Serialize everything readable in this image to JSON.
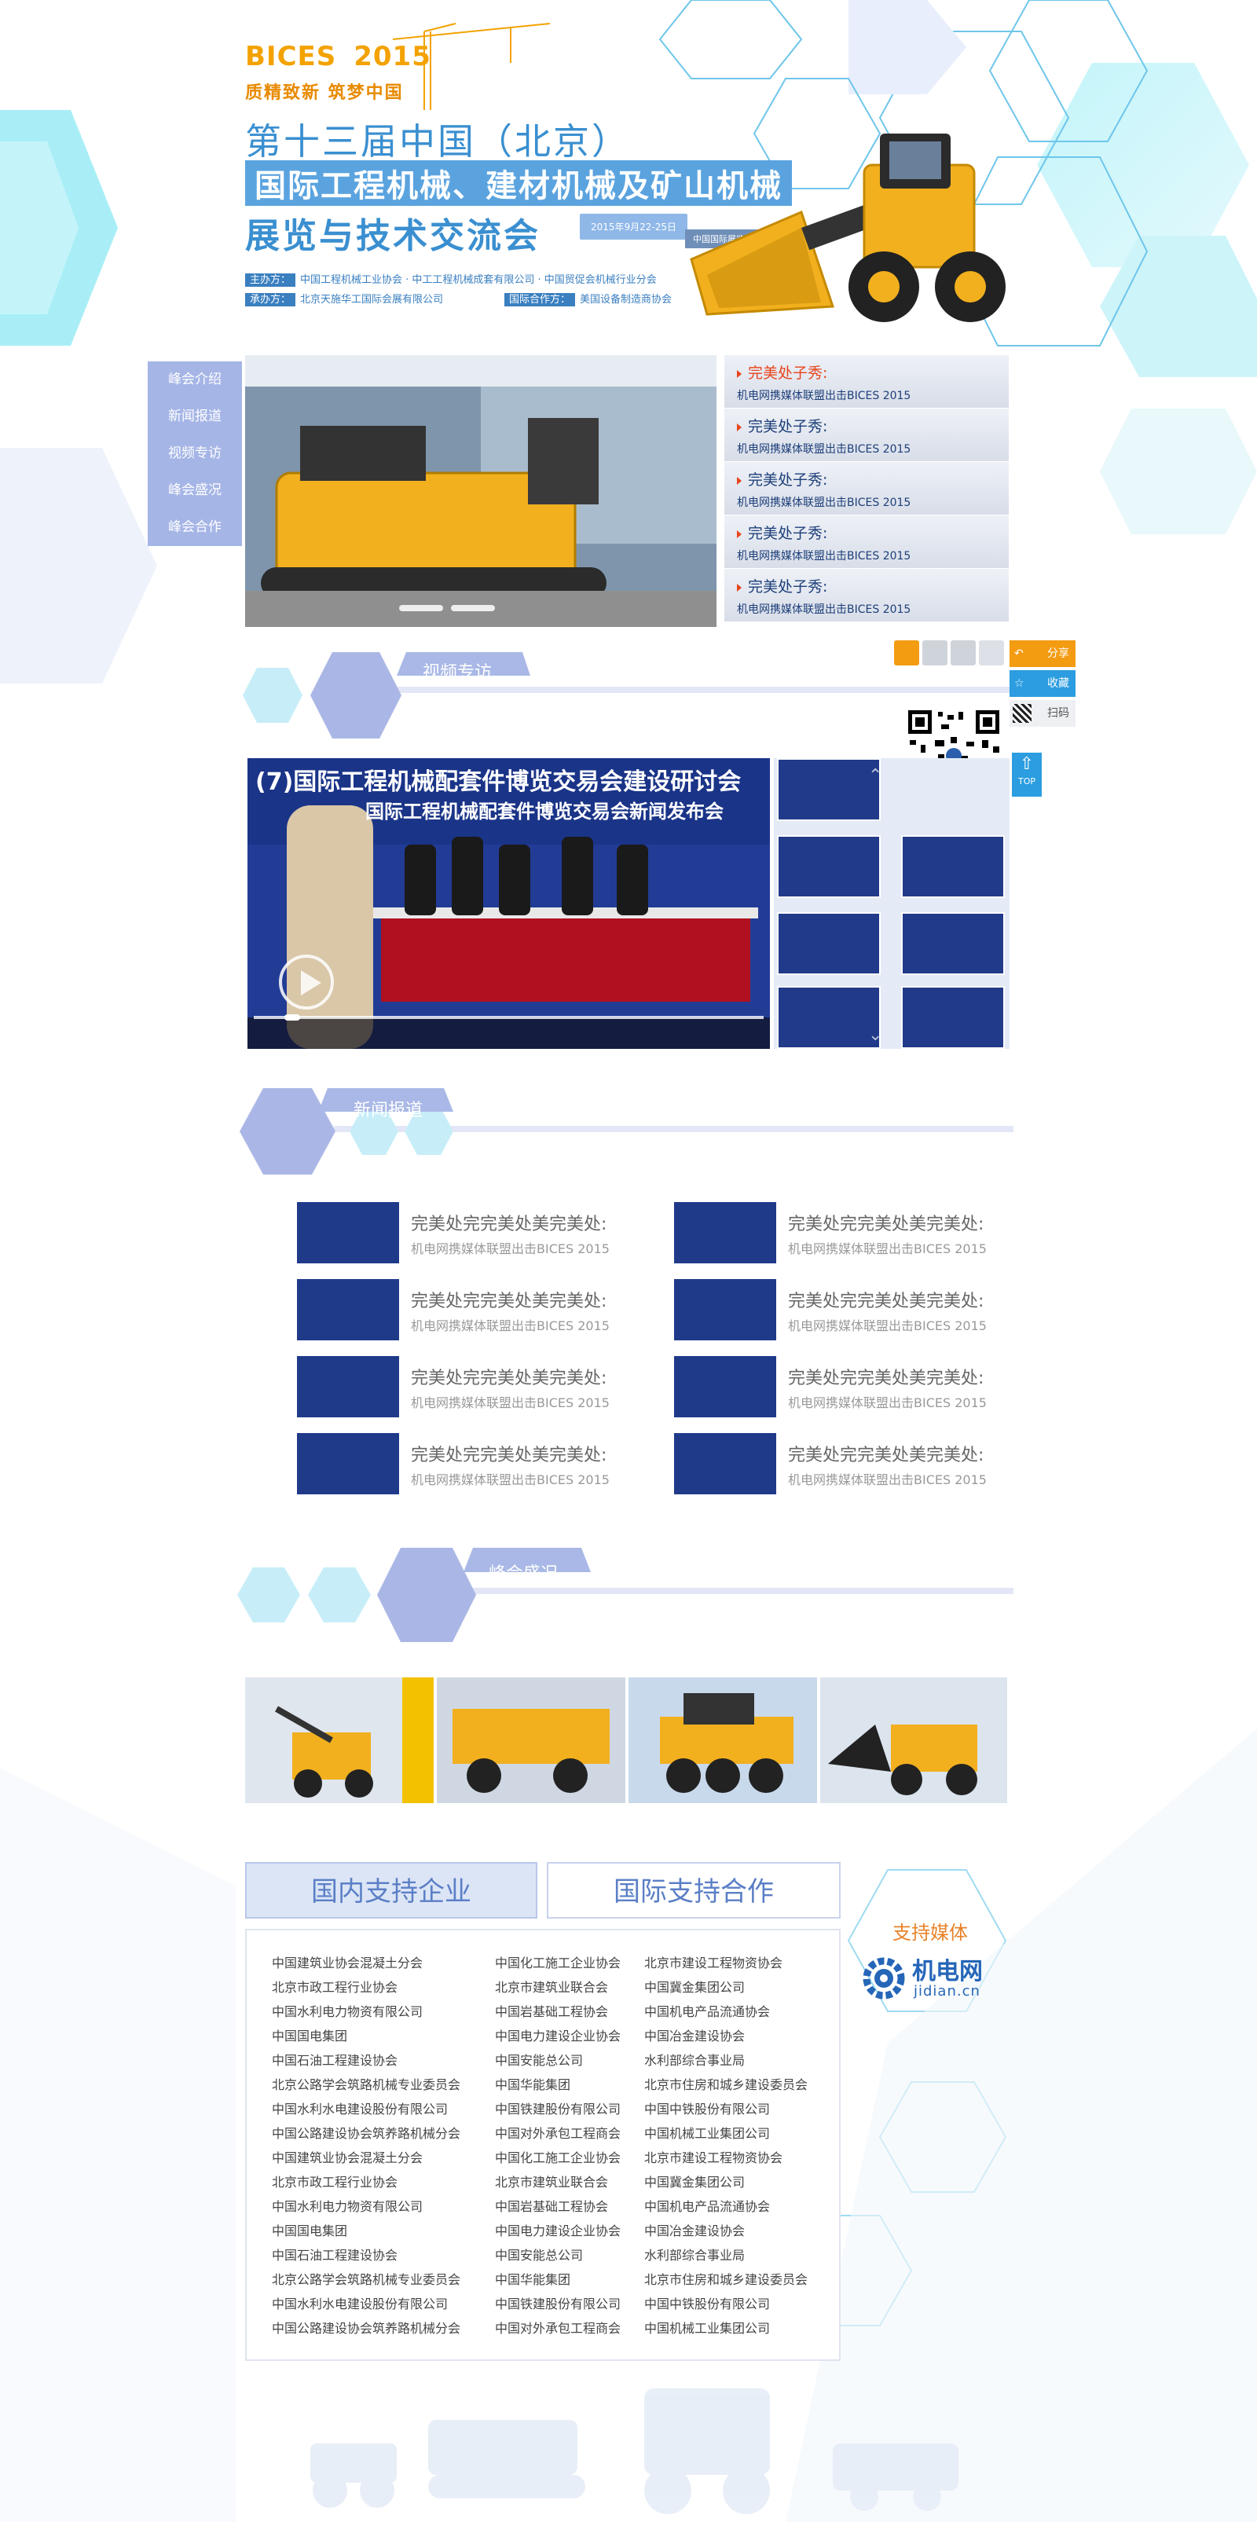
{
  "header": {
    "brand": "BICES",
    "year": "2015",
    "slogan": "质精致新  筑梦中国",
    "title_line1": "第十三届中国（北京）",
    "title_line2": "国际工程机械、建材机械及矿山机械",
    "title_line3": "展览与技术交流会",
    "date": "2015年9月22-25日",
    "venue": "中国国际展览中心新馆",
    "organizer_label": "主办方：",
    "organizer": "中国工程机械工业协会 · 中工工程机械成套有限公司 · 中国贸促会机械行业分会",
    "coorganizer_label": "承办方：",
    "coorganizer": "北京天施华工国际会展有限公司",
    "intl_label": "国际合作方：",
    "intl": "美国设备制造商协会"
  },
  "sidenav": [
    "峰会介绍",
    "新闻报道",
    "视频专访",
    "峰会盛况",
    "峰会合作"
  ],
  "slider": {
    "active_dot": 1,
    "dot_count": 2
  },
  "right_list": [
    {
      "title": "完美处子秀:",
      "sub": "机电网携媒体联盟出击BICES 2015"
    },
    {
      "title": "完美处子秀:",
      "sub": "机电网携媒体联盟出击BICES 2015"
    },
    {
      "title": "完美处子秀:",
      "sub": "机电网携媒体联盟出击BICES 2015"
    },
    {
      "title": "完美处子秀:",
      "sub": "机电网携媒体联盟出击BICES 2015"
    },
    {
      "title": "完美处子秀:",
      "sub": "机电网携媒体联盟出击BICES 2015"
    }
  ],
  "share": {
    "share_label": "分享",
    "fav_label": "收藏",
    "scan_label": "扫码",
    "top_label": "TOP",
    "icons": [
      "weibo-icon",
      "wechat-icon",
      "star-icon",
      "bookmark-icon"
    ]
  },
  "sections": {
    "video": "视频专访",
    "news": "新闻报道",
    "gallery": "峰会盛况"
  },
  "video": {
    "banner": "国际工程机械配套件博览交易会新闻发布会",
    "banner_top": "(7)国际工程机械配套件博览交易会建设研讨会",
    "progress": 0.06
  },
  "news_items": [
    {
      "title": "完美处完完美处美完美处:",
      "sub": "机电网携媒体联盟出击BICES 2015"
    },
    {
      "title": "完美处完完美处美完美处:",
      "sub": "机电网携媒体联盟出击BICES 2015"
    },
    {
      "title": "完美处完完美处美完美处:",
      "sub": "机电网携媒体联盟出击BICES 2015"
    },
    {
      "title": "完美处完完美处美完美处:",
      "sub": "机电网携媒体联盟出击BICES 2015"
    },
    {
      "title": "完美处完完美处美完美处:",
      "sub": "机电网携媒体联盟出击BICES 2015"
    },
    {
      "title": "完美处完完美处美完美处:",
      "sub": "机电网携媒体联盟出击BICES 2015"
    },
    {
      "title": "完美处完完美处美完美处:",
      "sub": "机电网携媒体联盟出击BICES 2015"
    },
    {
      "title": "完美处完完美处美完美处:",
      "sub": "机电网携媒体联盟出击BICES 2015"
    }
  ],
  "supporters": {
    "tab_domestic": "国内支持企业",
    "tab_international": "国际支持合作",
    "media_title": "支持媒体",
    "media_name": "机电网",
    "media_domain": "jidian.cn",
    "col1": [
      "中国建筑业协会混凝土分会",
      "北京市政工程行业协会",
      "中国水利电力物资有限公司",
      "中国国电集团",
      "中国石油工程建设协会",
      "北京公路学会筑路机械专业委员会",
      "中国水利水电建设股份有限公司",
      "中国公路建设协会筑养路机械分会",
      "中国建筑业协会混凝土分会",
      "北京市政工程行业协会",
      "中国水利电力物资有限公司",
      "中国国电集团",
      "中国石油工程建设协会",
      "北京公路学会筑路机械专业委员会",
      "中国水利水电建设股份有限公司",
      "中国公路建设协会筑养路机械分会"
    ],
    "col2": [
      "中国化工施工企业协会",
      "北京市建筑业联合会",
      "中国岩基础工程协会",
      "中国电力建设企业协会",
      "中国安能总公司",
      "中国华能集团",
      "中国铁建股份有限公司",
      "中国对外承包工程商会",
      "中国化工施工企业协会",
      "北京市建筑业联合会",
      "中国岩基础工程协会",
      "中国电力建设企业协会",
      "中国安能总公司",
      "中国华能集团",
      "中国铁建股份有限公司",
      "中国对外承包工程商会"
    ],
    "col3": [
      "北京市建设工程物资协会",
      "中国冀金集团公司",
      "中国机电产品流通协会",
      "中国冶金建设协会",
      "水利部综合事业局",
      "北京市住房和城乡建设委员会",
      "中国中铁股份有限公司",
      "中国机械工业集团公司",
      "北京市建设工程物资协会",
      "中国冀金集团公司",
      "中国机电产品流通协会",
      "中国冶金建设协会",
      "水利部综合事业局",
      "北京市住房和城乡建设委员会",
      "中国中铁股份有限公司",
      "中国机械工业集团公司"
    ]
  },
  "colors": {
    "accent_blue": "#3a8fd0",
    "nav_purple": "#a5b5e6",
    "orange": "#f39c12",
    "active_red": "#e8441b"
  }
}
